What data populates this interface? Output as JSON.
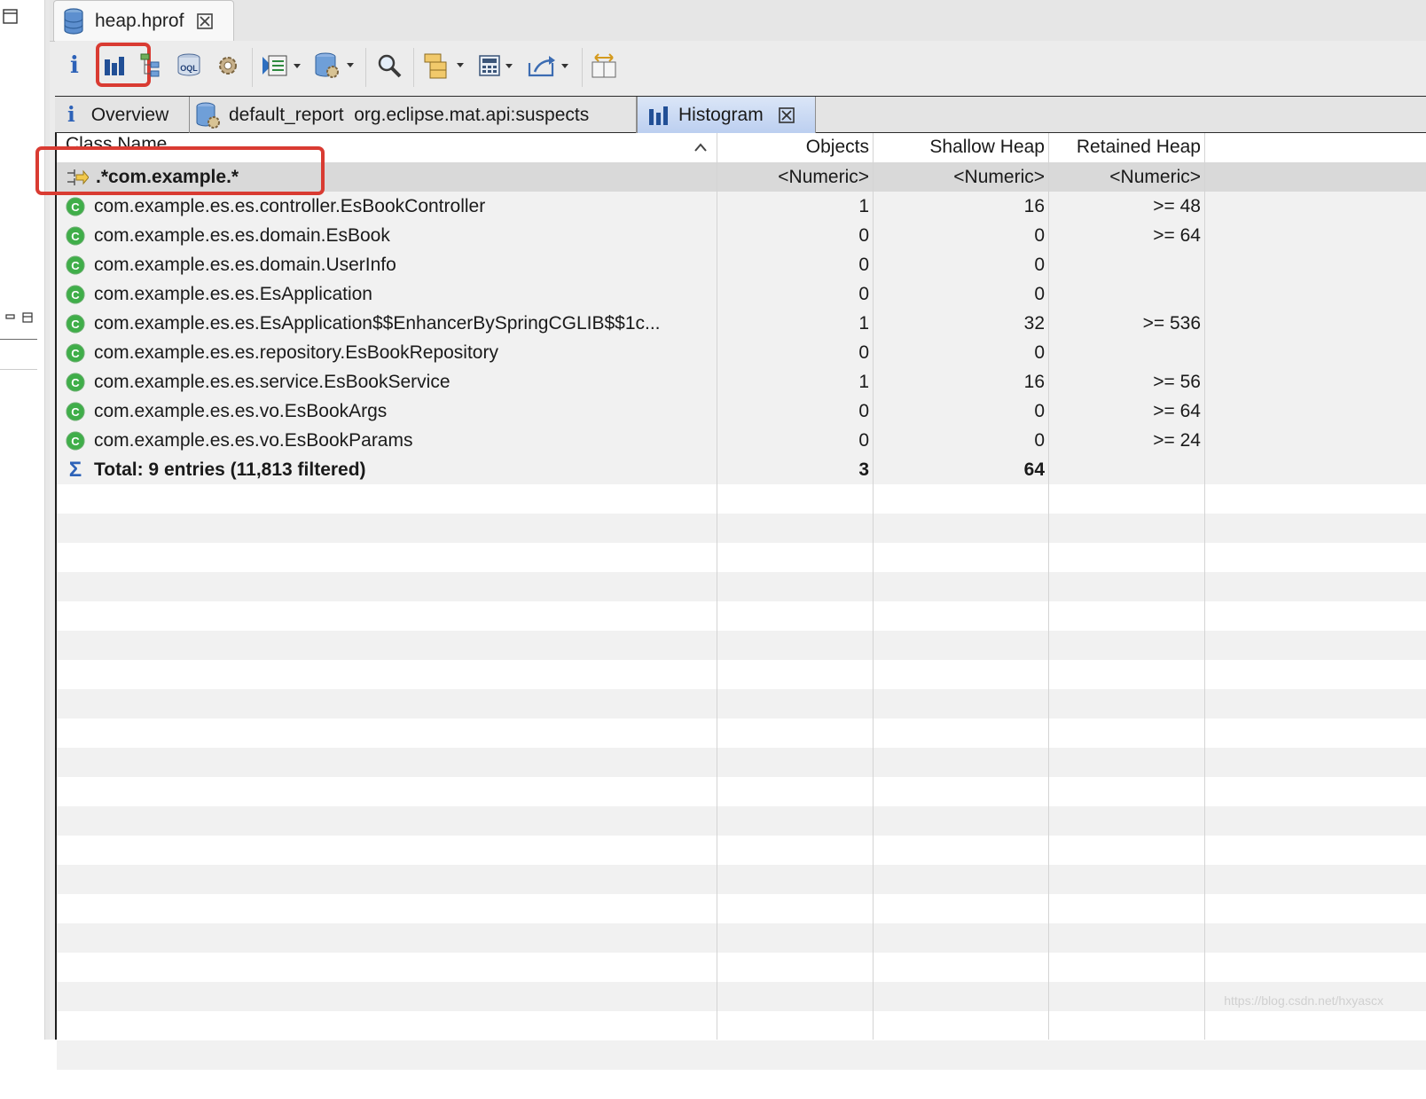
{
  "editor": {
    "tab_title": "heap.hprof"
  },
  "subtabs": [
    {
      "label": "Overview",
      "icon": "info-icon"
    },
    {
      "label": "default_report  org.eclipse.mat.api:suspects",
      "icon": "report-database-icon"
    },
    {
      "label": "Histogram",
      "icon": "histogram-icon",
      "active": true
    }
  ],
  "toolbar": {
    "info_label": "i",
    "items": [
      "info-icon",
      "histogram-icon",
      "dominator-tree-icon",
      "oql-icon",
      "heap-dump-details-icon",
      "run-report-icon",
      "query-browser-icon",
      "find-object-icon",
      "group-by-icon",
      "calculate-retained-icon",
      "export-icon",
      "compare-icon"
    ],
    "oql_label": "OQL"
  },
  "table": {
    "headers": {
      "name": "Class Name",
      "objects": "Objects",
      "shallow": "Shallow Heap",
      "retained": "Retained Heap"
    },
    "filter": {
      "name": ".*com.example.*",
      "objects": "<Numeric>",
      "shallow": "<Numeric>",
      "retained": "<Numeric>"
    },
    "rows": [
      {
        "name": "com.example.es.es.controller.EsBookController",
        "objects": "1",
        "shallow": "16",
        "retained": ">= 48"
      },
      {
        "name": "com.example.es.es.domain.EsBook",
        "objects": "0",
        "shallow": "0",
        "retained": ">= 64"
      },
      {
        "name": "com.example.es.es.domain.UserInfo",
        "objects": "0",
        "shallow": "0",
        "retained": ""
      },
      {
        "name": "com.example.es.es.EsApplication",
        "objects": "0",
        "shallow": "0",
        "retained": ""
      },
      {
        "name": "com.example.es.es.EsApplication$$EnhancerBySpringCGLIB$$1c...",
        "objects": "1",
        "shallow": "32",
        "retained": ">= 536"
      },
      {
        "name": "com.example.es.es.repository.EsBookRepository",
        "objects": "0",
        "shallow": "0",
        "retained": ""
      },
      {
        "name": "com.example.es.es.service.EsBookService",
        "objects": "1",
        "shallow": "16",
        "retained": ">= 56"
      },
      {
        "name": "com.example.es.es.vo.EsBookArgs",
        "objects": "0",
        "shallow": "0",
        "retained": ">= 64"
      },
      {
        "name": "com.example.es.es.vo.EsBookParams",
        "objects": "0",
        "shallow": "0",
        "retained": ">= 24"
      }
    ],
    "total": {
      "name": "Total: 9 entries (11,813 filtered)",
      "objects": "3",
      "shallow": "64",
      "retained": ""
    }
  },
  "watermark": "https://blog.csdn.net/hxyascx",
  "colors": {
    "highlight": "#d93b32",
    "class_icon": "#3fae49",
    "active_tab": "#c4d5f2"
  }
}
